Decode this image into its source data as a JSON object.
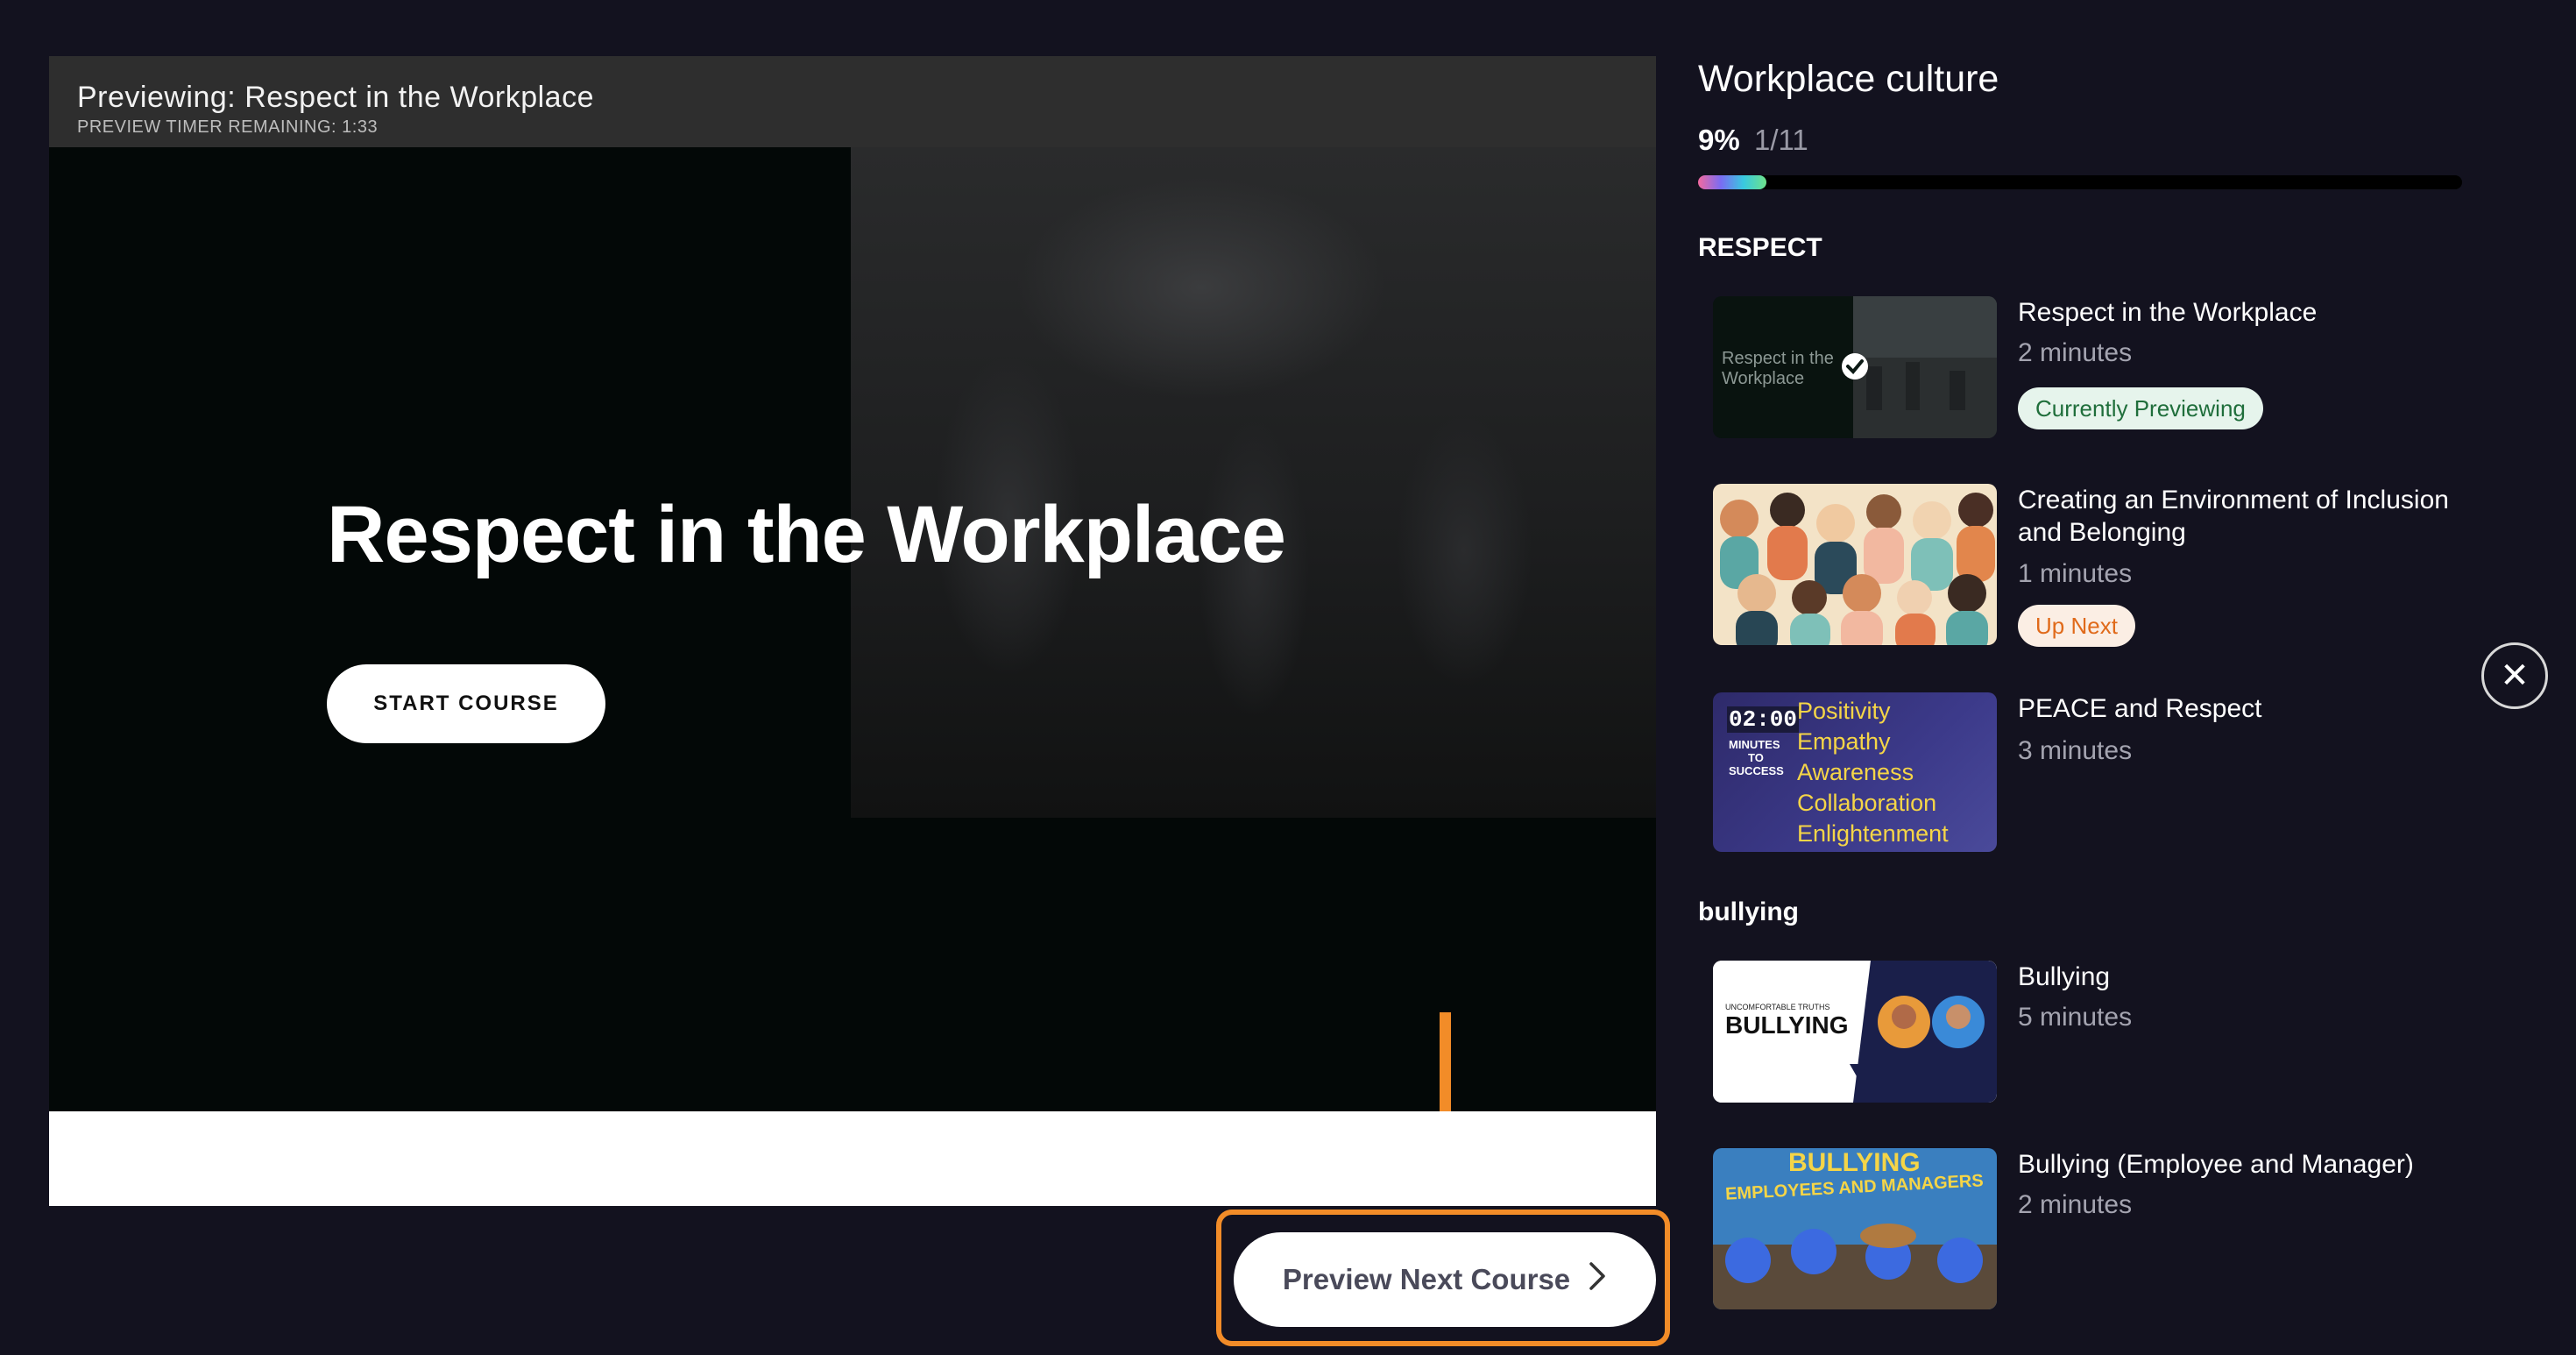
{
  "player": {
    "header_title": "Previewing: Respect in the Workplace",
    "timer_text": "PREVIEW TIMER REMAINING: 1:33",
    "hero_title": "Respect in the Workplace",
    "start_button": "START COURSE"
  },
  "next_button": {
    "label": "Preview Next Course",
    "icon": "chevron-right-icon"
  },
  "sidebar": {
    "title": "Workplace culture",
    "percent": "9%",
    "count": "1/11",
    "progress_fraction": 0.09,
    "sections": [
      {
        "name": "RESPECT",
        "courses": [
          {
            "title": "Respect in the Workplace",
            "duration": "2 minutes",
            "badge": "Currently Previewing",
            "thumb_text": "Respect in the Workplace"
          },
          {
            "title": "Creating an Environment of Inclusion and Belonging",
            "duration": "1 minutes",
            "badge": "Up Next"
          },
          {
            "title": "PEACE and Respect",
            "duration": "3 minutes",
            "thumb": {
              "timer": "02:00",
              "caption": [
                "MINUTES",
                "TO",
                "SUCCESS"
              ],
              "words": [
                "Positivity",
                "Empathy",
                "Awareness",
                "Collaboration",
                "Enlightenment"
              ]
            }
          }
        ]
      },
      {
        "name": "bullying",
        "courses": [
          {
            "title": "Bullying",
            "duration": "5 minutes",
            "thumb": {
              "kicker": "UNCOMFORTABLE TRUTHS",
              "headline": "BULLYING"
            }
          },
          {
            "title": "Bullying (Employee and Manager)",
            "duration": "2 minutes",
            "thumb": {
              "line1": "BULLYING",
              "line2": "EMPLOYEES AND MANAGERS"
            }
          }
        ]
      }
    ]
  },
  "close_button": {
    "icon": "close-icon",
    "glyph": "✕"
  },
  "colors": {
    "accent_orange": "#f28c28",
    "background": "#13121f",
    "badge_green": "#1f6e3b",
    "badge_orange": "#e06a1a"
  }
}
